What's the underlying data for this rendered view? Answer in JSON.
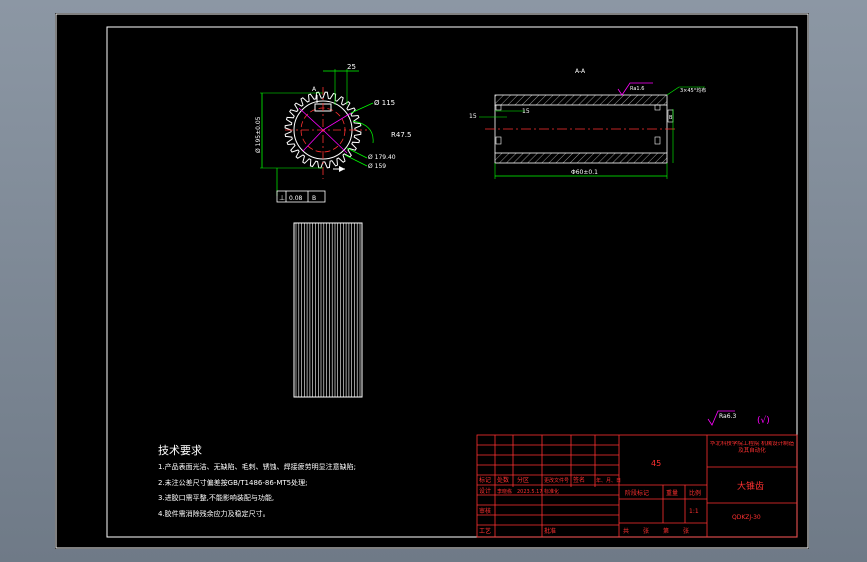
{
  "section_label": "A-A",
  "gear_dims": {
    "width_key": "25",
    "d_outer": "Ø 115",
    "r_arc": "R47.5",
    "d_pitch": "Ø 179.40",
    "d_root": "Ø 159",
    "d_left": "Ø 195±0.05",
    "datum_a": "A",
    "datum_b": "B",
    "tolerance_box": [
      "⊥",
      "0.08",
      "B"
    ]
  },
  "sleeve_dims": {
    "roughness_top": "Ra1.6",
    "chamfer": "3×45°均布",
    "side_width": "15",
    "inner_width": "15",
    "length": "Φ60±0.1"
  },
  "roughness_note": {
    "value": "Ra6.3",
    "suffix": "(√)"
  },
  "tech_requirements": {
    "title": "技术要求",
    "items": [
      "1.产品表面光洁、无缺陷、毛刺、锈蚀、焊接疲劳明显注意缺陷;",
      "2.未注公差尺寸偏差按GB/T1486-86-MT5处理;",
      "3.进胶口需平整,不能影响装配与功能,",
      "4.胶件需消除残余应力及稳定尺寸。"
    ]
  },
  "title_block": {
    "material": "45",
    "school": "华北科技学院工程院 机械设计制造及其自动化",
    "part_name": "大锥齿",
    "drawing_no": "QDKZJ-30",
    "row_labels": [
      "标记",
      "处数",
      "分区",
      "更改文件号",
      "签名",
      "年、月、日"
    ],
    "design_row": [
      "设计",
      "李晓栋",
      "2023.5.17",
      "标准化"
    ],
    "audit_label": "审核",
    "craft_label": "工艺",
    "approve_label": "批准",
    "stage_labels": [
      "阶段标记",
      "重量",
      "比例"
    ],
    "scale": "1:1",
    "sheet_labels": [
      "共",
      "张",
      "第",
      "张"
    ]
  }
}
